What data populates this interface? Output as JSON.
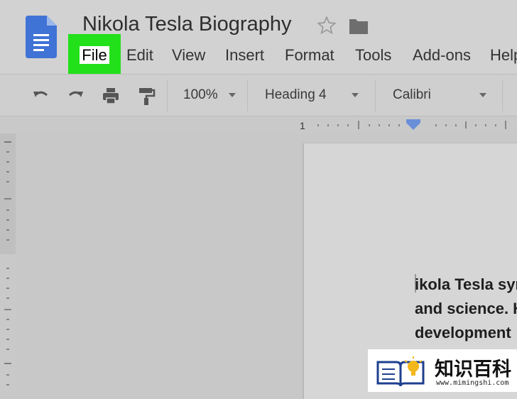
{
  "document": {
    "title": "Nikola Tesla Biography"
  },
  "header_icons": [
    "docs-logo-icon",
    "star-icon",
    "folder-icon"
  ],
  "menu": {
    "items": [
      {
        "label": "File",
        "highlighted": true
      },
      {
        "label": "Edit"
      },
      {
        "label": "View"
      },
      {
        "label": "Insert"
      },
      {
        "label": "Format"
      },
      {
        "label": "Tools"
      },
      {
        "label": "Add-ons"
      },
      {
        "label": "Help"
      }
    ],
    "highlight_color": "#22e11a"
  },
  "toolbar": {
    "icons": [
      "undo-icon",
      "redo-icon",
      "print-icon",
      "paint-format-icon"
    ],
    "zoom": "100%",
    "style": "Heading 4",
    "font": "Calibri"
  },
  "ruler": {
    "start_label": "1"
  },
  "body_text": {
    "lines": [
      "ikola Tesla sym",
      "and science. H",
      "development"
    ]
  },
  "watermark": {
    "brand": "知识百科",
    "url": "www.mimingshi.com"
  }
}
